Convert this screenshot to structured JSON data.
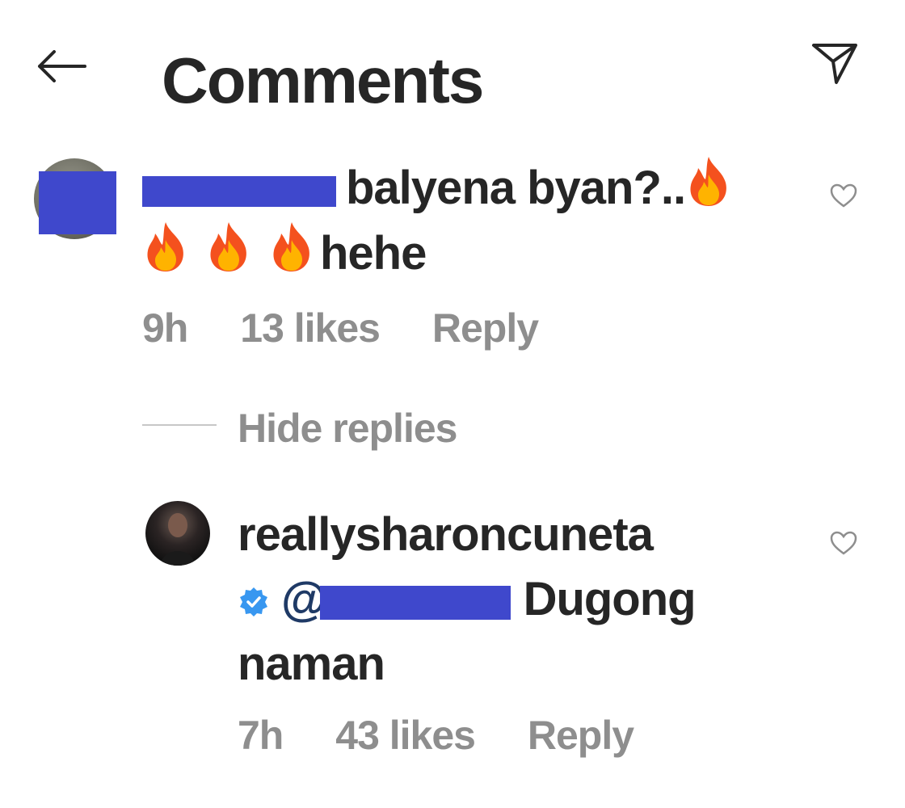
{
  "header": {
    "title": "Comments",
    "back_icon": "arrow-left-icon",
    "share_icon": "paper-plane-icon"
  },
  "comments": [
    {
      "username_redacted": true,
      "text_line1": "balyena byan?..",
      "text_line2": "hehe",
      "time": "9h",
      "likes": "13 likes",
      "reply": "Reply",
      "emoji": "fire-emoji"
    }
  ],
  "replies_toggle": "Hide replies",
  "replies": [
    {
      "username": "reallysharoncuneta",
      "verified_icon": "verified-badge-icon",
      "mention_prefix": "@",
      "text_line1": "Dugong",
      "text_line2": "naman",
      "time": "7h",
      "likes": "43 likes",
      "reply": "Reply"
    }
  ],
  "colors": {
    "text": "#262626",
    "secondary": "#8e8e8e",
    "redaction": "#3f48cc",
    "verified": "#3897f0"
  }
}
